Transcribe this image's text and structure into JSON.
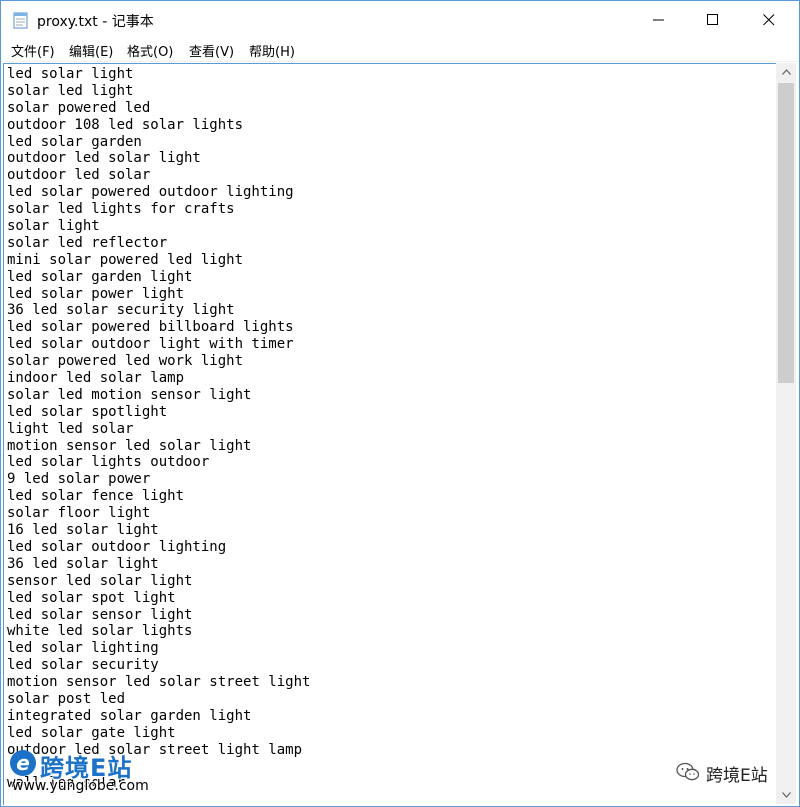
{
  "window": {
    "title": "proxy.txt - 记事本"
  },
  "menu": {
    "items": [
      {
        "label": "文件(F)"
      },
      {
        "label": "编辑(E)"
      },
      {
        "label": "格式(O)"
      },
      {
        "label": "查看(V)"
      },
      {
        "label": "帮助(H)"
      }
    ]
  },
  "content": {
    "lines": [
      "led solar light",
      "solar led light",
      "solar powered led",
      "outdoor 108 led solar lights",
      "led solar garden",
      "outdoor led solar light",
      "outdoor led solar",
      "led solar powered outdoor lighting",
      "solar led lights for crafts",
      "solar light",
      "solar led reflector",
      "mini solar powered led light",
      "led solar garden light",
      "led solar power light",
      "36 led solar security light",
      "led solar powered billboard lights",
      "led solar outdoor light with timer",
      "solar powered led work light",
      "indoor led solar lamp",
      "solar led motion sensor light",
      "led solar spotlight",
      "light led solar",
      "motion sensor led solar light",
      "led solar lights outdoor",
      "9 led solar power",
      "led solar fence light",
      "solar floor light",
      "16 led solar light",
      "led solar outdoor lighting",
      "36 led solar light",
      "sensor led solar light",
      "led solar spot light",
      "led solar sensor light",
      "white led solar lights",
      "led solar lighting",
      "led solar security",
      "motion sensor led solar street light",
      "solar post led",
      "integrated solar garden light",
      "led solar gate light",
      "outdoor led solar street light lamp",
      "",
      "wall led solar"
    ]
  },
  "watermark": {
    "logo_letter": "e",
    "logo_text": "跨境E站",
    "url": "www.yunglobe.com",
    "account_name": "跨境E站"
  },
  "colors": {
    "window_border": "#5b9bd5",
    "logo_blue": "#1d72c8",
    "scrollbar_track": "#f0f0f0",
    "scrollbar_thumb": "#cdcdcd"
  },
  "icons": {
    "app": "notepad-icon",
    "minimize": "minimize-icon",
    "maximize": "maximize-icon",
    "close": "close-icon",
    "scroll_up": "scroll-up-arrow-icon",
    "scroll_down": "scroll-down-arrow-icon",
    "wechat": "wechat-icon"
  }
}
